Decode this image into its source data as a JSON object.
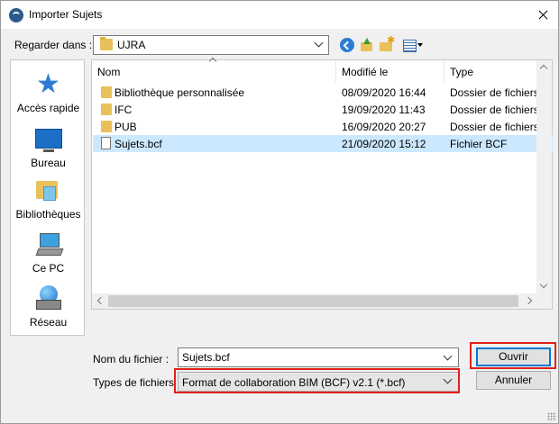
{
  "window": {
    "title": "Importer Sujets"
  },
  "look_in": {
    "label": "Regarder dans :",
    "value": "UJRA"
  },
  "toolbar": {
    "back_icon": "back-arrow-icon",
    "up_icon": "folder-up-icon",
    "new_folder_icon": "new-folder-icon",
    "views_icon": "view-menu-icon"
  },
  "places": [
    {
      "label": "Accès rapide",
      "icon": "quick-access-star-icon"
    },
    {
      "label": "Bureau",
      "icon": "desktop-icon"
    },
    {
      "label": "Bibliothèques",
      "icon": "libraries-icon"
    },
    {
      "label": "Ce PC",
      "icon": "computer-icon"
    },
    {
      "label": "Réseau",
      "icon": "network-icon"
    }
  ],
  "file_list": {
    "columns": {
      "name": "Nom",
      "modified": "Modifié le",
      "type": "Type"
    },
    "rows": [
      {
        "name": "Bibliothèque personnalisée",
        "modified": "08/09/2020 16:44",
        "type": "Dossier de fichiers",
        "kind": "folder"
      },
      {
        "name": "IFC",
        "modified": "19/09/2020 11:43",
        "type": "Dossier de fichiers",
        "kind": "folder"
      },
      {
        "name": "PUB",
        "modified": "16/09/2020 20:27",
        "type": "Dossier de fichiers",
        "kind": "folder"
      },
      {
        "name": "Sujets.bcf",
        "modified": "21/09/2020 15:12",
        "type": "Fichier BCF",
        "kind": "file",
        "selected": true
      }
    ]
  },
  "file_name": {
    "label": "Nom du fichier :",
    "value": "Sujets.bcf"
  },
  "file_type": {
    "label": "Types de fichiers :",
    "value": "Format de collaboration BIM (BCF) v2.1  (*.bcf)"
  },
  "buttons": {
    "open": "Ouvrir",
    "cancel": "Annuler"
  },
  "colors": {
    "selection": "#cce8ff",
    "highlight_box": "#e0201c",
    "accent": "#0078d7"
  }
}
